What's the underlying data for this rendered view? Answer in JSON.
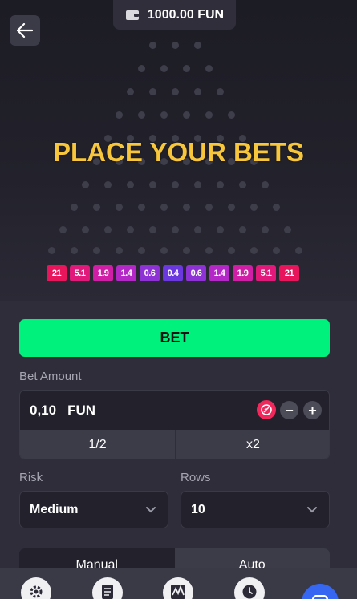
{
  "header": {
    "balance": "1000.00 FUN"
  },
  "board": {
    "title": "PLACE YOUR BETS",
    "multipliers": [
      {
        "label": "21",
        "color": "#e8145c"
      },
      {
        "label": "5.1",
        "color": "#e0197a"
      },
      {
        "label": "1.9",
        "color": "#d01fa6"
      },
      {
        "label": "1.4",
        "color": "#b528c8"
      },
      {
        "label": "0.6",
        "color": "#8e32d6"
      },
      {
        "label": "0.4",
        "color": "#6b38df"
      },
      {
        "label": "0.6",
        "color": "#8e32d6"
      },
      {
        "label": "1.4",
        "color": "#b528c8"
      },
      {
        "label": "1.9",
        "color": "#d01fa6"
      },
      {
        "label": "5.1",
        "color": "#e0197a"
      },
      {
        "label": "21",
        "color": "#e8145c"
      }
    ]
  },
  "controls": {
    "bet_label": "BET",
    "bet_amount_label": "Bet Amount",
    "amount_value": "0,10",
    "amount_currency": "FUN",
    "minus": "−",
    "plus": "+",
    "half": "1/2",
    "double": "x2",
    "risk_label": "Risk",
    "risk_value": "Medium",
    "rows_label": "Rows",
    "rows_value": "10",
    "mode_manual": "Manual",
    "mode_auto": "Auto"
  },
  "nav": {
    "icons": [
      "gear-icon",
      "document-icon",
      "chart-icon",
      "clock-icon",
      "chat-icon"
    ]
  },
  "colors": {
    "accent_green": "#00f27c",
    "title_yellow": "#f8c63a",
    "chat_blue": "#3567f2"
  }
}
